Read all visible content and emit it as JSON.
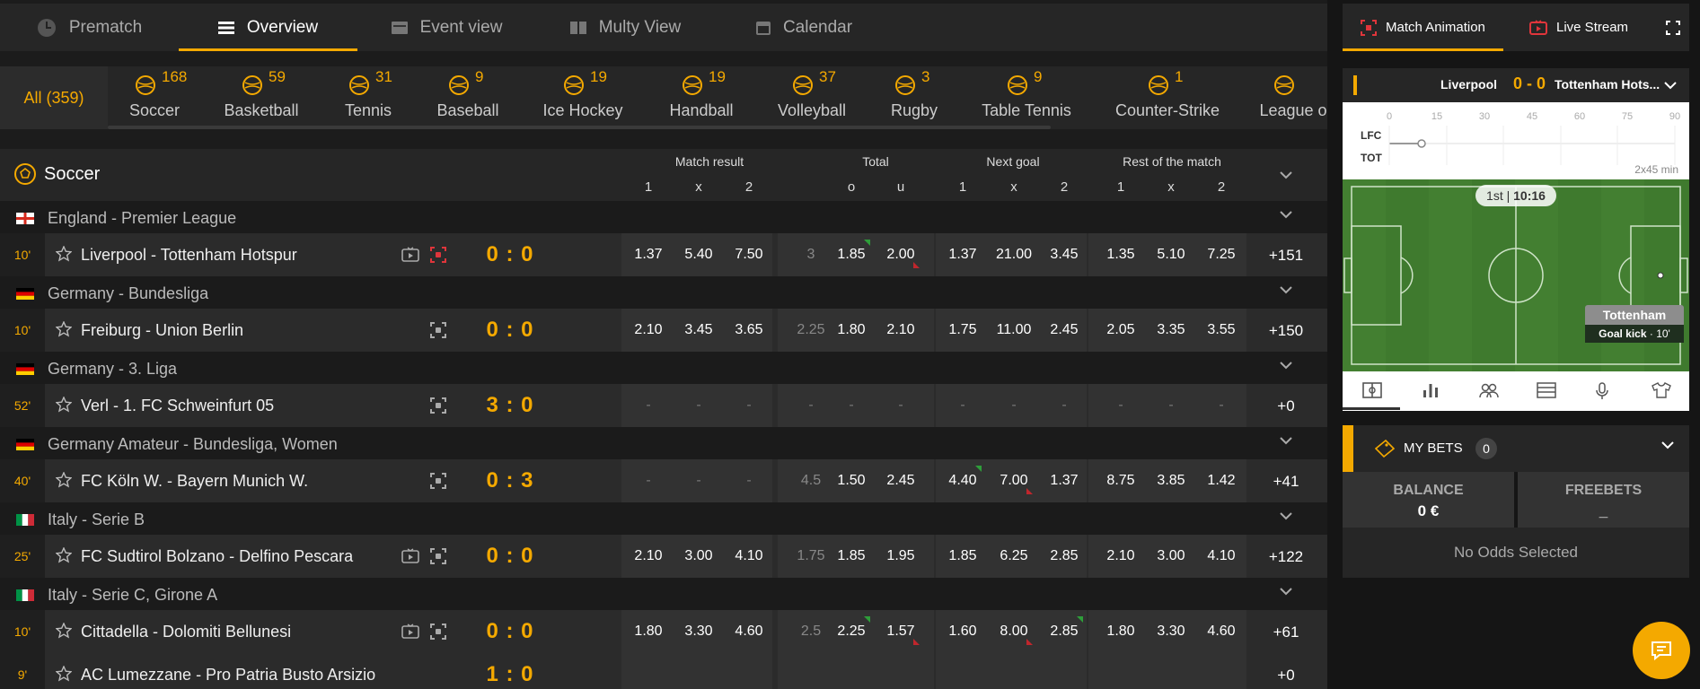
{
  "nav": {
    "tabs": [
      "Prematch",
      "Overview",
      "Event view",
      "Multy View",
      "Calendar"
    ]
  },
  "sports": {
    "all": "All (359)",
    "items": [
      {
        "name": "Soccer",
        "count": "168"
      },
      {
        "name": "Basketball",
        "count": "59"
      },
      {
        "name": "Tennis",
        "count": "31"
      },
      {
        "name": "Baseball",
        "count": "9"
      },
      {
        "name": "Ice Hockey",
        "count": "19"
      },
      {
        "name": "Handball",
        "count": "19"
      },
      {
        "name": "Volleyball",
        "count": "37"
      },
      {
        "name": "Rugby",
        "count": "3"
      },
      {
        "name": "Table Tennis",
        "count": "9"
      },
      {
        "name": "Counter-Strike",
        "count": "1"
      },
      {
        "name": "League o",
        "count": ""
      }
    ]
  },
  "table": {
    "sport_title": "Soccer",
    "groups": [
      "Match result",
      "Total",
      "Next goal",
      "Rest of the match"
    ],
    "subheaders": [
      "1",
      "x",
      "2",
      "o",
      "u",
      "1",
      "x",
      "2",
      "1",
      "x",
      "2"
    ]
  },
  "leagues": [
    {
      "name": "England - Premier League",
      "flag": "england",
      "match": {
        "time": "10'",
        "teams": "Liverpool - Tottenham Hotspur",
        "tv": true,
        "anim_active": true,
        "score": "0 : 0",
        "odds": [
          "1.37",
          "5.40",
          "7.50",
          "3",
          "1.85",
          "2.00",
          "1.37",
          "21.00",
          "3.45",
          "1.35",
          "5.10",
          "7.25"
        ],
        "more": "+151",
        "up": [
          4
        ],
        "down": [
          5
        ]
      }
    },
    {
      "name": "Germany - Bundesliga",
      "flag": "germany",
      "match": {
        "time": "10'",
        "teams": "Freiburg - Union Berlin",
        "tv": false,
        "anim_active": false,
        "score": "0 : 0",
        "odds": [
          "2.10",
          "3.45",
          "3.65",
          "2.25",
          "1.80",
          "2.10",
          "1.75",
          "11.00",
          "2.45",
          "2.05",
          "3.35",
          "3.55"
        ],
        "more": "+150",
        "up": [],
        "down": []
      }
    },
    {
      "name": "Germany - 3. Liga",
      "flag": "germany",
      "match": {
        "time": "52'",
        "teams": "Verl - 1. FC Schweinfurt 05",
        "tv": false,
        "anim_active": false,
        "score": "3 : 0",
        "odds": [
          "-",
          "-",
          "-",
          "-",
          "-",
          "-",
          "-",
          "-",
          "-",
          "-",
          "-",
          "-"
        ],
        "more": "+0",
        "up": [],
        "down": []
      }
    },
    {
      "name": "Germany Amateur - Bundesliga, Women",
      "flag": "germany",
      "match": {
        "time": "40'",
        "teams": "FC Köln W. - Bayern Munich W.",
        "tv": false,
        "anim_active": false,
        "score": "0 : 3",
        "odds": [
          "-",
          "-",
          "-",
          "4.5",
          "1.50",
          "2.45",
          "4.40",
          "7.00",
          "1.37",
          "8.75",
          "3.85",
          "1.42"
        ],
        "more": "+41",
        "up": [
          6
        ],
        "down": [
          7
        ]
      }
    },
    {
      "name": "Italy - Serie B",
      "flag": "italy",
      "match": {
        "time": "25'",
        "teams": "FC Sudtirol Bolzano - Delfino Pescara",
        "tv": true,
        "anim_active": false,
        "score": "0 : 0",
        "odds": [
          "2.10",
          "3.00",
          "4.10",
          "1.75",
          "1.85",
          "1.95",
          "1.85",
          "6.25",
          "2.85",
          "2.10",
          "3.00",
          "4.10"
        ],
        "more": "+122",
        "up": [],
        "down": []
      }
    },
    {
      "name": "Italy - Serie C, Girone A",
      "flag": "italy",
      "match": {
        "time": "10'",
        "teams": "Cittadella - Dolomiti Bellunesi",
        "tv": true,
        "anim_active": false,
        "score": "0 : 0",
        "odds": [
          "1.80",
          "3.30",
          "4.60",
          "2.5",
          "2.25",
          "1.57",
          "1.60",
          "8.00",
          "2.85",
          "1.80",
          "3.30",
          "4.60"
        ],
        "more": "+61",
        "up": [
          4,
          8
        ],
        "down": [
          5,
          7
        ]
      }
    }
  ],
  "partial_row": {
    "time": "9'",
    "teams": "AC Lumezzane - Pro Patria Busto Arsizio",
    "score": "1 : 0",
    "more": "+0"
  },
  "side": {
    "tabs": [
      "Match Animation",
      "Live Stream"
    ],
    "match": {
      "home": "Liverpool",
      "score": "0 - 0",
      "away": "Tottenham Hots..."
    },
    "timeline": {
      "ticks": [
        "0",
        "15",
        "30",
        "45",
        "60",
        "75",
        "90"
      ],
      "home_abbr": "LFC",
      "away_abbr": "TOT",
      "duration": "2x45 min"
    },
    "pitch": {
      "period": "1st",
      "clock": "10:16",
      "event_team": "Tottenham",
      "event_name": "Goal kick",
      "event_minute": "· 10'"
    },
    "bets": {
      "label": "MY BETS",
      "count": "0",
      "balance_label": "BALANCE",
      "balance_value": "0 €",
      "freebets_label": "FREEBETS",
      "freebets_value": "_",
      "empty": "No Odds Selected"
    }
  },
  "colors": {
    "accent": "#f4a900",
    "up": "#2e9e3a",
    "down": "#c0262c"
  }
}
